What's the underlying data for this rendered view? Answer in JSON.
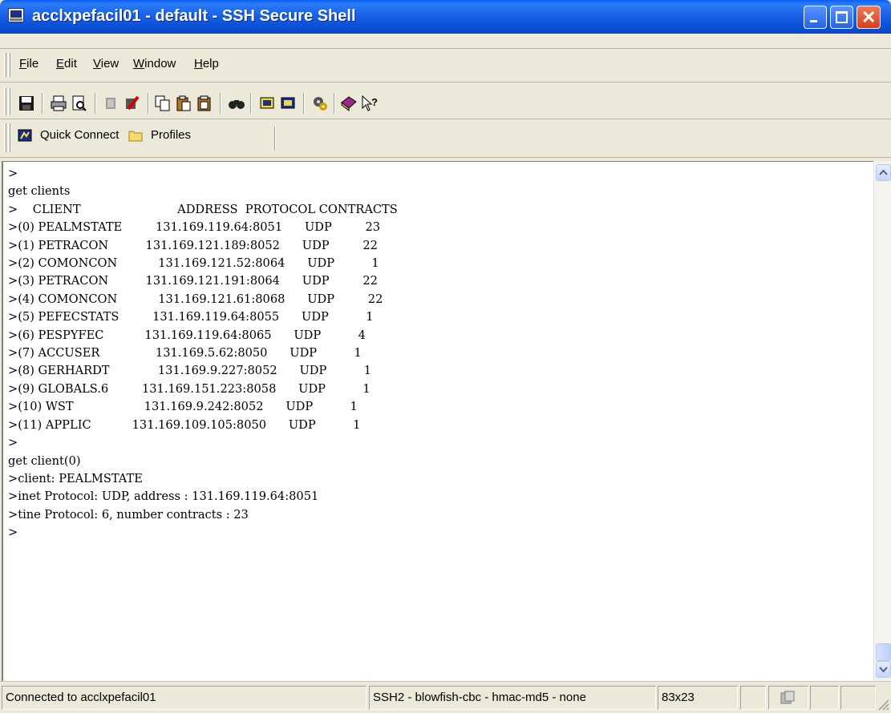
{
  "window": {
    "title": "acclxpefacil01 - default - SSH Secure Shell"
  },
  "menu": [
    {
      "label": "File",
      "u": "F",
      "rest": "ile"
    },
    {
      "label": "Edit",
      "u": "E",
      "rest": "dit"
    },
    {
      "label": "View",
      "u": "V",
      "rest": "iew"
    },
    {
      "label": "Window",
      "u": "W",
      "rest": "indow"
    },
    {
      "label": "Help",
      "u": "H",
      "rest": "elp"
    }
  ],
  "toolbar": {
    "icons": [
      "save-icon",
      "print-icon",
      "print-preview-icon",
      "disconnect-icon",
      "disconnect-alt-icon",
      "copy-icon",
      "paste-icon",
      "paste-alt-icon",
      "find-icon",
      "new-terminal-icon",
      "new-file-transfer-icon",
      "settings-icon",
      "help-book-icon",
      "whats-this-icon"
    ]
  },
  "quickbar": {
    "quick_connect": "Quick Connect",
    "profiles": "Profiles"
  },
  "terminal": {
    "lines": [
      ">",
      "get clients",
      ">    CLIENT                          ADDRESS  PROTOCOL CONTRACTS",
      ">(0) PEALMSTATE         131.169.119.64:8051      UDP         23",
      ">(1) PETRACON          131.169.121.189:8052      UDP         22",
      ">(2) COMONCON           131.169.121.52:8064      UDP          1",
      ">(3) PETRACON          131.169.121.191:8064      UDP         22",
      ">(4) COMONCON           131.169.121.61:8068      UDP         22",
      ">(5) PEFECSTATS         131.169.119.64:8055      UDP          1",
      ">(6) PESPYFEC           131.169.119.64:8065      UDP          4",
      ">(7) ACCUSER               131.169.5.62:8050      UDP          1",
      ">(8) GERHARDT             131.169.9.227:8052      UDP          1",
      ">(9) GLOBALS.6         131.169.151.223:8058      UDP          1",
      ">(10) WST                   131.169.9.242:8052      UDP          1",
      ">(11) APPLIC           131.169.109.105:8050      UDP          1",
      ">",
      "get client(0)",
      ">client: PEALMSTATE",
      ">inet Protocol: UDP, address : 131.169.119.64:8051",
      ">tine Protocol: 6, number contracts : 23",
      ">"
    ]
  },
  "status": {
    "connection": "Connected to acclxpefacil01",
    "cipher": "SSH2 - blowfish-cbc - hmac-md5 - none",
    "size": "83x23"
  }
}
